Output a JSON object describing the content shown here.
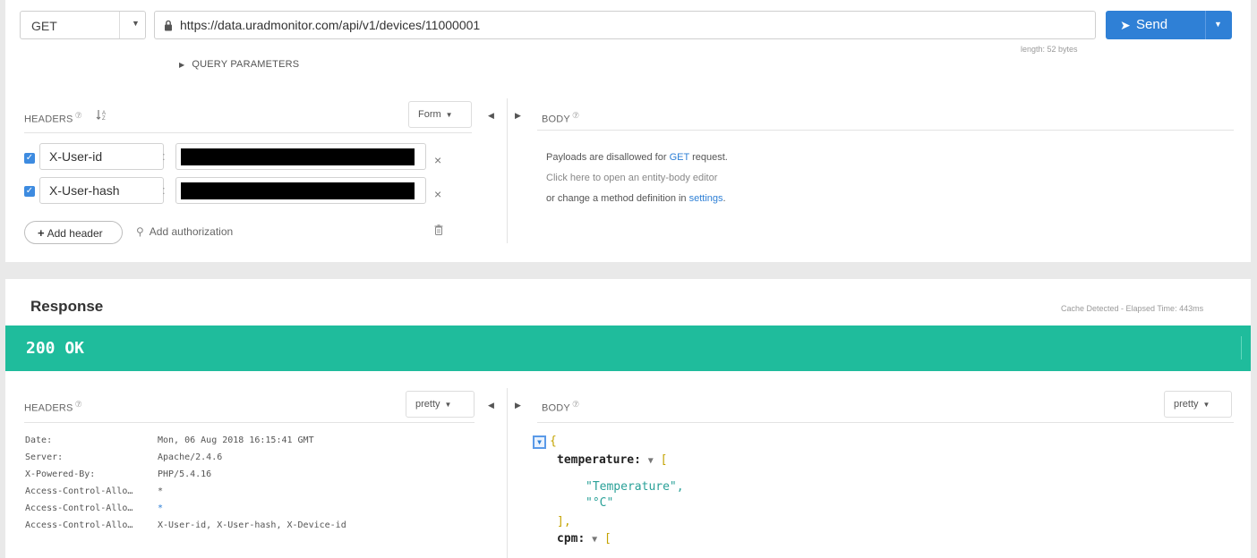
{
  "request": {
    "method": "GET",
    "url": "https://data.uradmonitor.com/api/v1/devices/11000001",
    "send_label": "Send",
    "length_note": "length: 52 bytes",
    "query_params_label": "QUERY PARAMETERS",
    "headers_label": "HEADERS",
    "help_mark": "⑦",
    "form_label": "Form",
    "body_label": "BODY",
    "headers": [
      {
        "name": "X-User-id",
        "checked": true
      },
      {
        "name": "X-User-hash",
        "checked": true
      }
    ],
    "add_header_label": "Add header",
    "add_auth_label": "Add authorization",
    "body_message": {
      "line1_prefix": "Payloads are disallowed for",
      "line1_link": "GET",
      "line1_suffix": "request.",
      "line2": "Click here to open an entity-body editor",
      "line3_prefix": "or change a method definition in",
      "line3_link": "settings",
      "line3_suffix": "."
    }
  },
  "response": {
    "title": "Response",
    "cache_note": "Cache Detected - Elapsed Time: 443ms",
    "status": "200 OK",
    "headers_label": "HEADERS",
    "pretty_label": "pretty",
    "body_label": "BODY",
    "headers": [
      {
        "key": "Date:",
        "value": "Mon, 06 Aug 2018 16:15:41 GMT"
      },
      {
        "key": "Server:",
        "value": "Apache/2.4.6"
      },
      {
        "key": "X-Powered-By:",
        "value": "PHP/5.4.16"
      },
      {
        "key": "Access-Control-Allo…",
        "value": "*"
      },
      {
        "key": "Access-Control-Allo…",
        "value": "*"
      },
      {
        "key": "Access-Control-Allo…",
        "value": "X-User-id, X-User-hash, X-Device-id"
      }
    ],
    "body_json": {
      "open_brace": "{",
      "key1": "temperature:",
      "key1_open": "[",
      "key1_val1": "\"Temperature\",",
      "key1_val2": "\"°C\"",
      "key1_close": "],",
      "key2": "cpm:",
      "key2_open": "["
    }
  },
  "colors": {
    "accent": "#2f80d6",
    "status_ok": "#1fbc9c"
  },
  "icons": [
    "lock-icon",
    "send-icon",
    "sort-icon",
    "help-icon",
    "close-icon",
    "plus-icon",
    "key-icon",
    "trash-icon",
    "chevron-down-icon",
    "collapse-icon"
  ]
}
